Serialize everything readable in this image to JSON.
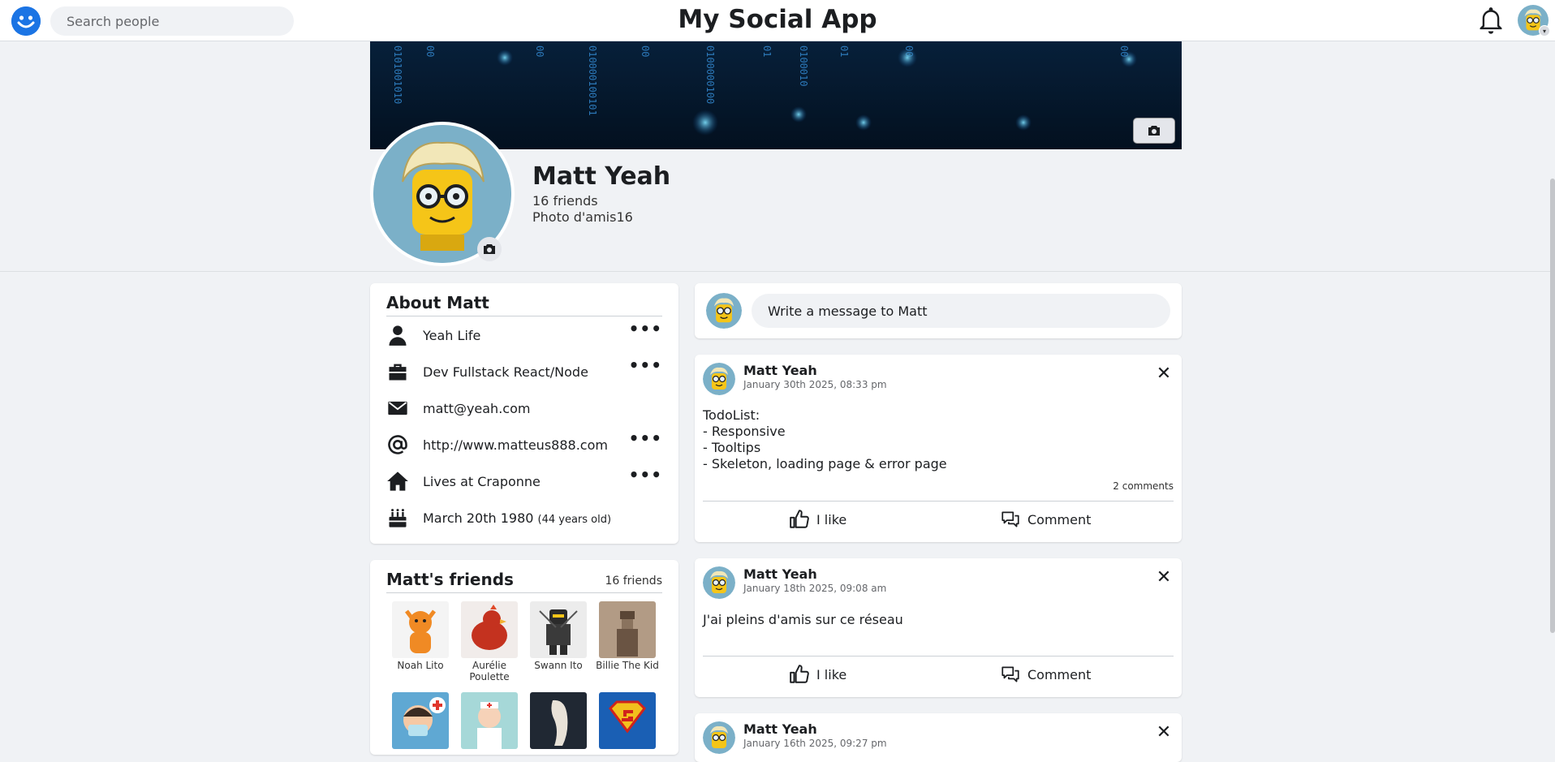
{
  "app": {
    "title": "My Social App"
  },
  "search": {
    "placeholder": "Search people"
  },
  "profile": {
    "name": "Matt Yeah",
    "friends_count": "16 friends",
    "photo_label": "Photo d'amis16"
  },
  "about": {
    "title": "About Matt",
    "items": [
      {
        "icon": "user-icon",
        "text": "Yeah Life",
        "has_menu": true
      },
      {
        "icon": "briefcase-icon",
        "text": "Dev Fullstack React/Node",
        "has_menu": true
      },
      {
        "icon": "envelope-icon",
        "text": "matt@yeah.com",
        "has_menu": false
      },
      {
        "icon": "at-icon",
        "text": "http://www.matteus888.com",
        "has_menu": true
      },
      {
        "icon": "home-icon",
        "text": "Lives at Craponne",
        "has_menu": true
      },
      {
        "icon": "birthday-cake-icon",
        "text": "March 20th 1980",
        "sub": "(44 years old)",
        "has_menu": false
      }
    ],
    "menu_label": "•••"
  },
  "friends": {
    "title": "Matt's friends",
    "count": "16 friends",
    "list": [
      {
        "name": "Noah Lito",
        "avatar_color": "#f4f4f4"
      },
      {
        "name": "Aurélie Poulette",
        "avatar_color": "#f1ecea"
      },
      {
        "name": "Swann Ito",
        "avatar_color": "#ececec"
      },
      {
        "name": "Billie The Kid",
        "avatar_color": "#b29b85"
      },
      {
        "name": "",
        "avatar_color": "#5fa8d3"
      },
      {
        "name": "",
        "avatar_color": "#a6d8d8"
      },
      {
        "name": "",
        "avatar_color": "#202833"
      },
      {
        "name": "",
        "avatar_color": "#1a5fb4"
      }
    ]
  },
  "composer": {
    "placeholder": "Write a message to Matt"
  },
  "posts": [
    {
      "author": "Matt Yeah",
      "date": "January 30th 2025, 08:33 pm",
      "body": "TodoList:\n- Responsive\n- Tooltips\n- Skeleton, loading page & error page",
      "comments": "2 comments"
    },
    {
      "author": "Matt Yeah",
      "date": "January 18th 2025, 09:08 am",
      "body": "J'ai pleins d'amis sur ce réseau",
      "comments": ""
    },
    {
      "author": "Matt Yeah",
      "date": "January 16th 2025, 09:27 pm",
      "body": "",
      "comments": ""
    }
  ],
  "actions": {
    "like": "I like",
    "comment": "Comment"
  },
  "colors": {
    "accent": "#1b74e4",
    "background": "#f0f2f5",
    "card": "#ffffff"
  }
}
